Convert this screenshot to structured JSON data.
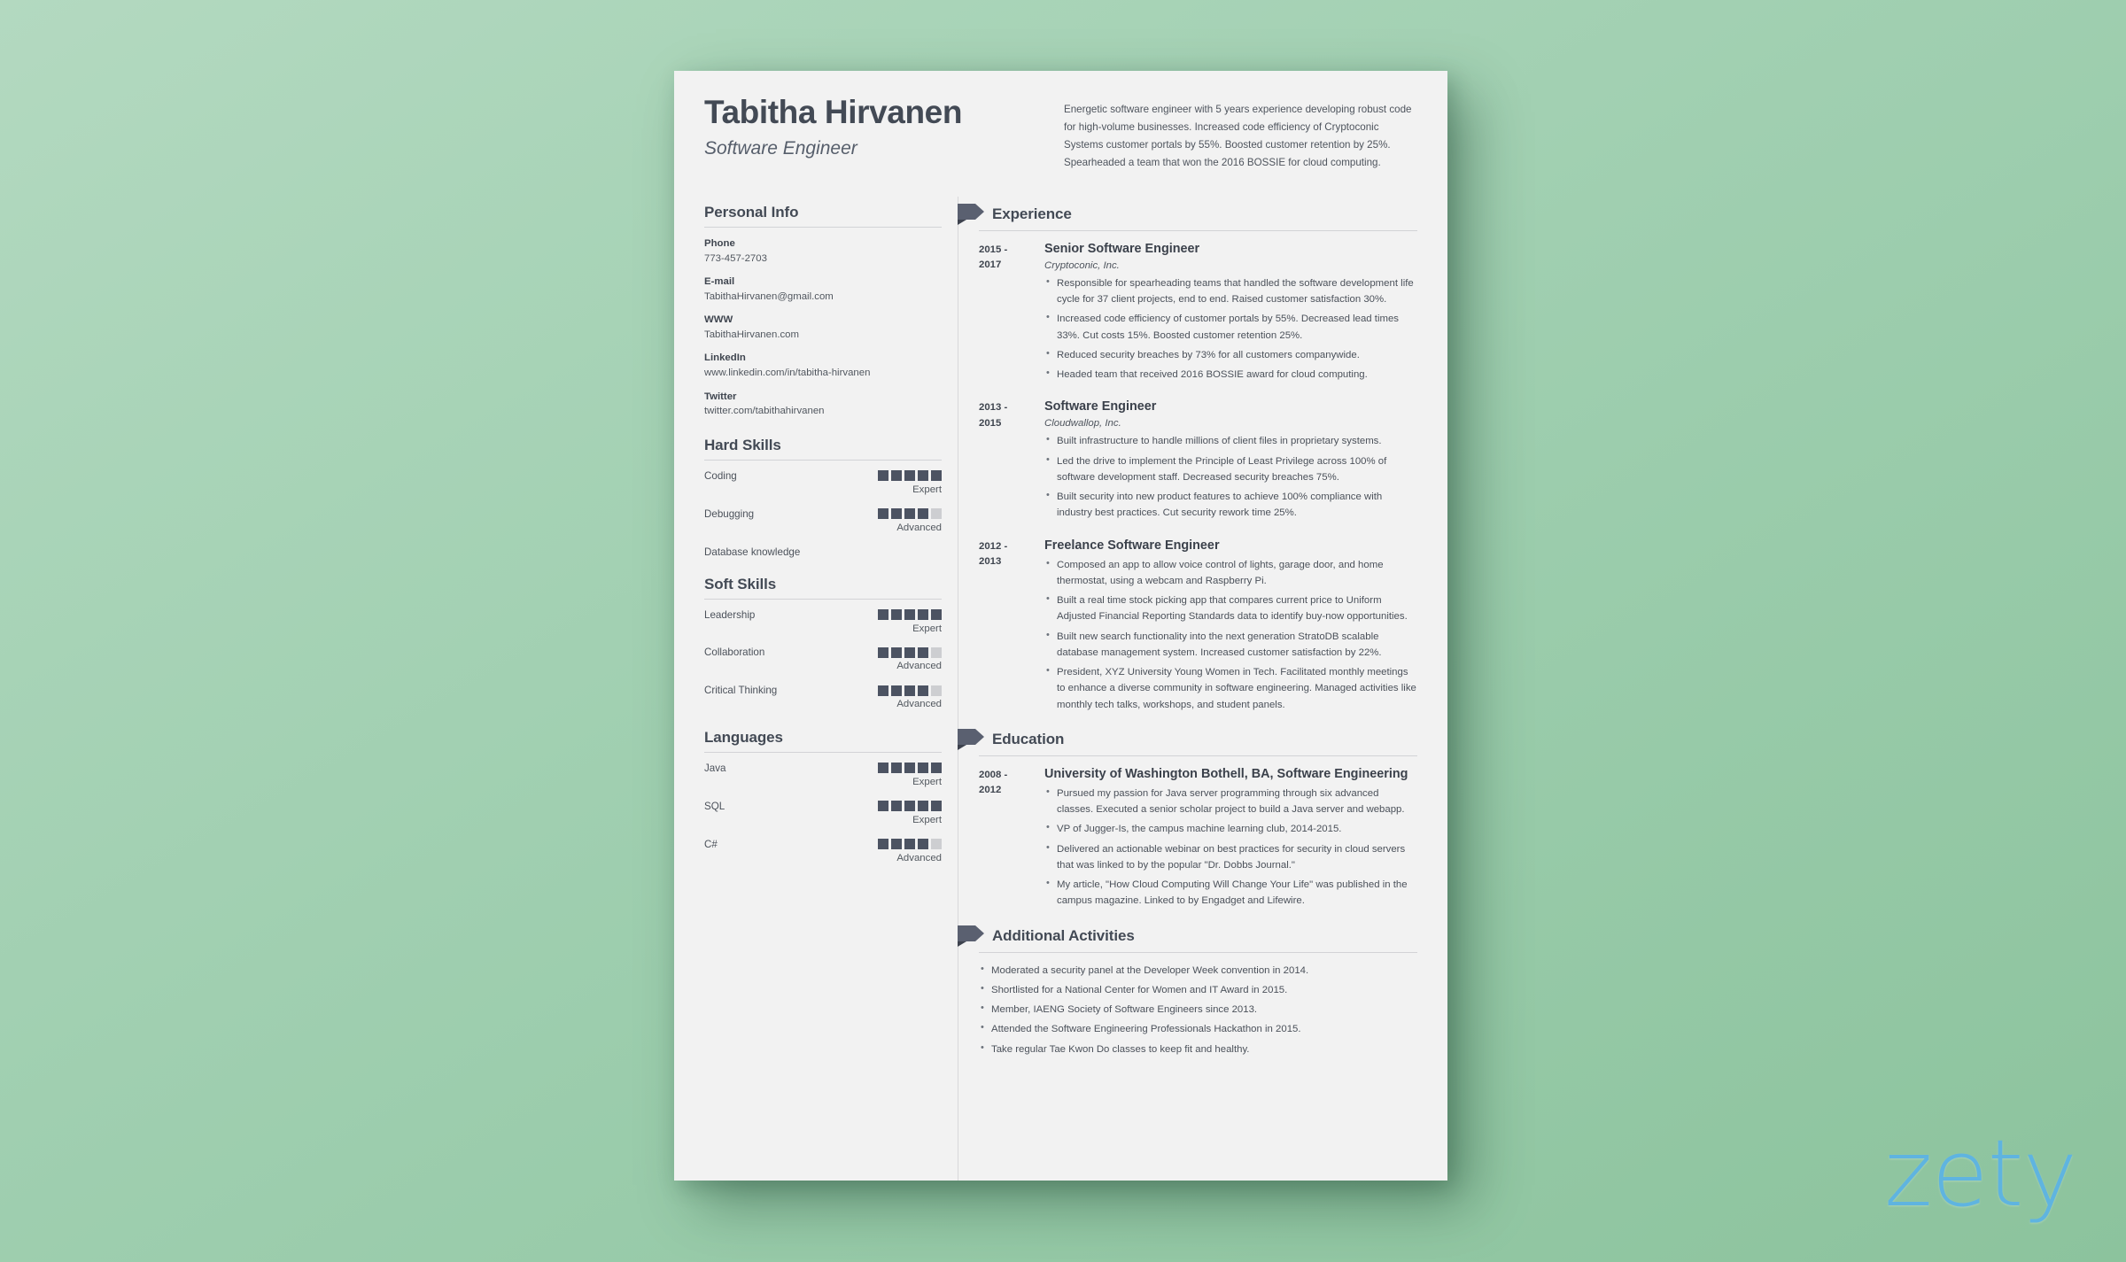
{
  "background": {
    "top_color": "#b3d9c0",
    "bottom_color": "#8cc39d",
    "page_color": "#f2f2f2"
  },
  "accent": {
    "dark_slate": "#4c5362",
    "text": "#434a55",
    "rule": "#d2d3d6",
    "logo_blue": "#5fb4e0"
  },
  "watermark": {
    "logo_text": "zety"
  },
  "header": {
    "name": "Tabitha Hirvanen",
    "job_title": "Software Engineer",
    "summary": "Energetic software engineer with 5 years experience developing robust code for high-volume businesses. Increased code efficiency of Cryptoconic Systems customer portals by 55%. Boosted customer retention by 25%. Spearheaded a team that won the 2016 BOSSIE for cloud computing."
  },
  "sidebar": {
    "personal_info": {
      "title": "Personal Info",
      "items": [
        {
          "label": "Phone",
          "value": "773-457-2703"
        },
        {
          "label": "E-mail",
          "value": "TabithaHirvanen@gmail.com"
        },
        {
          "label": "WWW",
          "value": "TabithaHirvanen.com"
        },
        {
          "label": "LinkedIn",
          "value": "www.linkedin.com/in/tabitha-hirvanen"
        },
        {
          "label": "Twitter",
          "value": "twitter.com/tabithahirvanen"
        }
      ]
    },
    "hard_skills": {
      "title": "Hard Skills",
      "items": [
        {
          "name": "Coding",
          "filled": 5,
          "total": 5,
          "level": "Expert"
        },
        {
          "name": "Debugging",
          "filled": 4,
          "total": 5,
          "level": "Advanced"
        },
        {
          "name": "Database knowledge",
          "filled": 0,
          "total": 0,
          "level": ""
        }
      ]
    },
    "soft_skills": {
      "title": "Soft Skills",
      "items": [
        {
          "name": "Leadership",
          "filled": 5,
          "total": 5,
          "level": "Expert"
        },
        {
          "name": "Collaboration",
          "filled": 4,
          "total": 5,
          "level": "Advanced"
        },
        {
          "name": "Critical Thinking",
          "filled": 4,
          "total": 5,
          "level": "Advanced"
        }
      ]
    },
    "languages": {
      "title": "Languages",
      "items": [
        {
          "name": "Java",
          "filled": 5,
          "total": 5,
          "level": "Expert"
        },
        {
          "name": "SQL",
          "filled": 5,
          "total": 5,
          "level": "Expert"
        },
        {
          "name": "C#",
          "filled": 4,
          "total": 5,
          "level": "Advanced"
        }
      ]
    }
  },
  "main": {
    "experience": {
      "title": "Experience",
      "entries": [
        {
          "dates": "2015 - 2017",
          "role": "Senior Software Engineer",
          "company": "Cryptoconic, Inc.",
          "bullets": [
            "Responsible for spearheading teams that handled the software development life cycle for 37 client projects, end to end.  Raised customer satisfaction 30%.",
            "Increased code efficiency of customer portals by 55%. Decreased lead times 33%. Cut costs 15%. Boosted customer retention 25%.",
            "Reduced security breaches by 73% for all customers companywide.",
            "Headed team that received 2016 BOSSIE award for cloud computing."
          ]
        },
        {
          "dates": "2013 - 2015",
          "role": "Software Engineer",
          "company": "Cloudwallop, Inc.",
          "bullets": [
            "Built infrastructure to handle millions of client files in proprietary systems.",
            "Led the drive to implement the Principle of Least Privilege across 100% of software development staff. Decreased security breaches 75%.",
            "Built security into new product features to achieve 100% compliance with industry best practices. Cut security rework time 25%."
          ]
        },
        {
          "dates": "2012 - 2013",
          "role": "Freelance Software Engineer",
          "company": "",
          "bullets": [
            "Composed an app to allow voice control of lights, garage door, and home thermostat, using a webcam and Raspberry Pi.",
            "Built a real time stock picking app that compares current price to Uniform Adjusted Financial Reporting Standards data to identify buy-now opportunities.",
            "Built new search functionality into the next generation StratoDB scalable database management system. Increased customer satisfaction by 22%.",
            "President, XYZ University Young Women in Tech. Facilitated monthly meetings to enhance a diverse community in software engineering. Managed activities like monthly tech talks, workshops, and student panels."
          ]
        }
      ]
    },
    "education": {
      "title": "Education",
      "entries": [
        {
          "dates": "2008 - 2012",
          "role": "University of Washington Bothell, BA, Software Engineering",
          "company": "",
          "bullets": [
            "Pursued my passion for Java server programming through six advanced classes.  Executed a senior scholar project to build a Java server and webapp.",
            "VP of Jugger-Is, the campus machine learning club, 2014-2015.",
            "Delivered an actionable webinar on best practices for security in cloud servers that was linked to by the popular \"Dr. Dobbs Journal.\"",
            "My article, \"How Cloud Computing Will Change Your Life\" was published in the campus magazine. Linked to by Engadget and Lifewire."
          ]
        }
      ]
    },
    "additional_activities": {
      "title": "Additional Activities",
      "bullets": [
        "Moderated a security panel at the Developer Week convention in 2014.",
        "Shortlisted for a National Center for Women and IT Award in 2015.",
        "Member, IAENG Society of Software Engineers since 2013.",
        "Attended the Software Engineering Professionals Hackathon in 2015.",
        "Take regular Tae Kwon Do classes to keep fit and healthy."
      ]
    }
  }
}
